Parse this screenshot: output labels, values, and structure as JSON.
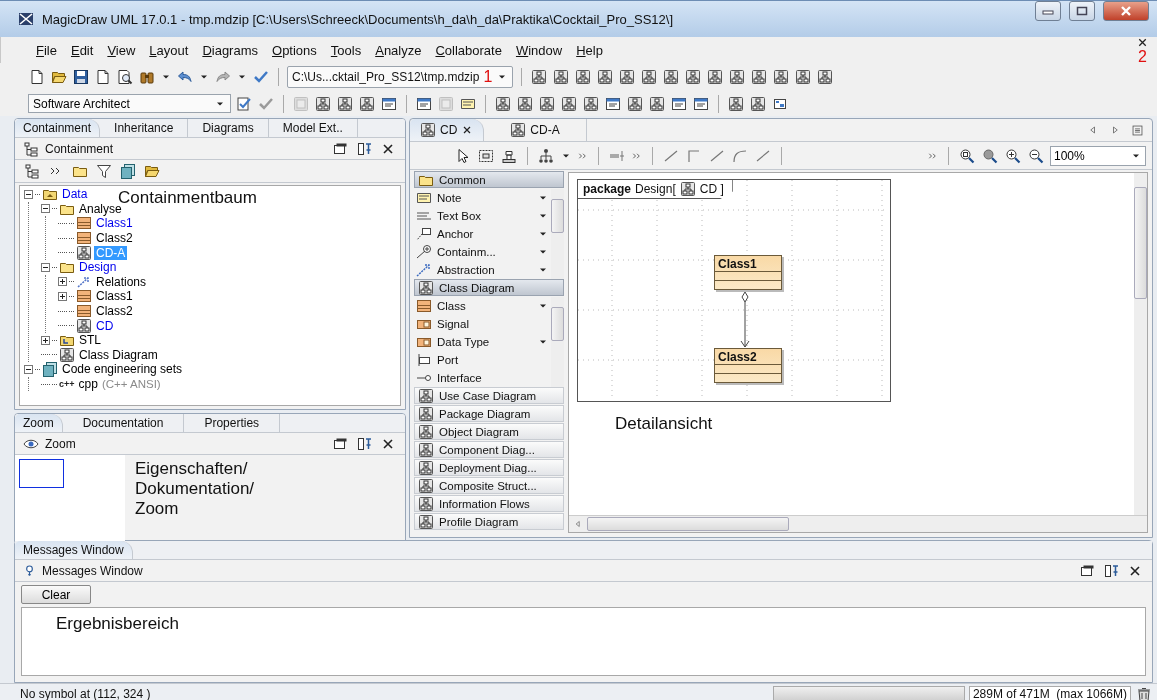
{
  "window": {
    "title": "MagicDraw UML 17.0.1 - tmp.mdzip [C:\\Users\\Schreeck\\Documents\\h_da\\h_da\\Praktika\\Cocktail_Pro_SS12\\]"
  },
  "menu": {
    "items": [
      "File",
      "Edit",
      "View",
      "Layout",
      "Diagrams",
      "Options",
      "Tools",
      "Analyze",
      "Collaborate",
      "Window",
      "Help"
    ],
    "marker": "2"
  },
  "toolbar": {
    "project_path": "C:\\Us...cktail_Pro_SS12\\tmp.mdzip",
    "marker": "1",
    "perspective": "Software Architect"
  },
  "browser": {
    "tabs": [
      {
        "label": "Containment",
        "selected": true
      },
      {
        "label": "Inheritance",
        "selected": false
      },
      {
        "label": "Diagrams",
        "selected": false
      },
      {
        "label": "Model Ext..",
        "selected": false
      }
    ],
    "title": "Containment",
    "annotation": "Containmentbaum",
    "tree": [
      {
        "label": "Data",
        "kind": "package",
        "color": "#0000ee",
        "selected": false,
        "expanded": true,
        "children": [
          {
            "label": "Analyse",
            "kind": "folder",
            "color": "#000000",
            "selected": false,
            "expanded": true,
            "children": [
              {
                "label": "Class1",
                "kind": "class",
                "color": "#0000ee",
                "selected": false
              },
              {
                "label": "Class2",
                "kind": "class",
                "color": "#000000",
                "selected": false
              },
              {
                "label": "CD-A",
                "kind": "diagram",
                "selected": true
              }
            ]
          },
          {
            "label": "Design",
            "kind": "folder",
            "color": "#0000ee",
            "selected": false,
            "expanded": true,
            "children": [
              {
                "label": "Relations",
                "kind": "relation",
                "color": "#000000",
                "selected": false,
                "expanded": false
              },
              {
                "label": "Class1",
                "kind": "class",
                "color": "#000000",
                "selected": false,
                "expanded": false
              },
              {
                "label": "Class2",
                "kind": "class",
                "color": "#000000",
                "selected": false
              },
              {
                "label": "CD",
                "kind": "diagram",
                "color": "#0000ee",
                "selected": false
              }
            ]
          },
          {
            "label": "STL",
            "kind": "library",
            "color": "#000000",
            "selected": false,
            "expanded": false
          },
          {
            "label": "Class Diagram",
            "kind": "diagram",
            "color": "#000000",
            "selected": false
          }
        ]
      },
      {
        "label": "Code engineering sets",
        "kind": "codeset",
        "color": "#000000",
        "selected": false,
        "expanded": true,
        "children": [
          {
            "label": "cpp",
            "kind": "cpp",
            "badge": "c++",
            "suffix": "(C++ ANSI)",
            "color": "#000000",
            "selected": false
          }
        ]
      }
    ]
  },
  "zoom_panel": {
    "tabs": [
      {
        "label": "Zoom",
        "selected": true
      },
      {
        "label": "Documentation",
        "selected": false
      },
      {
        "label": "Properties",
        "selected": false
      }
    ],
    "title": "Zoom",
    "annotation": [
      "Eigenschaften/",
      "Dokumentation/",
      "Zoom"
    ]
  },
  "editor": {
    "tabs": [
      {
        "label": "CD",
        "selected": true
      },
      {
        "label": "CD-A",
        "selected": false
      }
    ],
    "zoom": "100%",
    "palette": [
      {
        "label": "Common",
        "kind": "folder",
        "expanded": true,
        "items": [
          {
            "label": "Note",
            "kind": "note",
            "menu": true
          },
          {
            "label": "Text Box",
            "kind": "textbox",
            "menu": true
          },
          {
            "label": "Anchor",
            "kind": "anchor",
            "menu": true
          },
          {
            "label": "Containm...",
            "kind": "containment",
            "menu": true
          },
          {
            "label": "Abstraction",
            "kind": "abstraction",
            "menu": true
          }
        ]
      },
      {
        "label": "Class Diagram",
        "kind": "diagram",
        "expanded": true,
        "items": [
          {
            "label": "Class",
            "kind": "class",
            "menu": true
          },
          {
            "label": "Signal",
            "kind": "signal",
            "menu": false
          },
          {
            "label": "Data Type",
            "kind": "datatype",
            "menu": true
          },
          {
            "label": "Port",
            "kind": "port",
            "menu": false
          },
          {
            "label": "Interface",
            "kind": "interface",
            "menu": false
          }
        ]
      },
      {
        "label": "Use Case Diagram",
        "kind": "diagram",
        "expanded": false
      },
      {
        "label": "Package Diagram",
        "kind": "diagram",
        "expanded": false
      },
      {
        "label": "Object Diagram",
        "kind": "diagram",
        "expanded": false
      },
      {
        "label": "Component Diag...",
        "kind": "diagram",
        "expanded": false
      },
      {
        "label": "Deployment Diag...",
        "kind": "diagram",
        "expanded": false
      },
      {
        "label": "Composite Struct...",
        "kind": "diagram",
        "expanded": false
      },
      {
        "label": "Information Flows",
        "kind": "diagram",
        "expanded": false
      },
      {
        "label": "Profile Diagram",
        "kind": "diagram",
        "expanded": false
      }
    ],
    "diagram": {
      "keyword": "package",
      "name": "Design[",
      "ref": "CD ]",
      "classes": [
        "Class1",
        "Class2"
      ]
    },
    "annotation": "Detailansicht"
  },
  "messages": {
    "tab": "Messages Window",
    "title": "Messages Window",
    "button": "Clear",
    "annotation": "Ergebnisbereich"
  },
  "status_bar": {
    "message": "No symbol at (112, 324 )",
    "progress": {
      "level": 0
    },
    "memory": "289M of 471M  (max 1066M)"
  }
}
